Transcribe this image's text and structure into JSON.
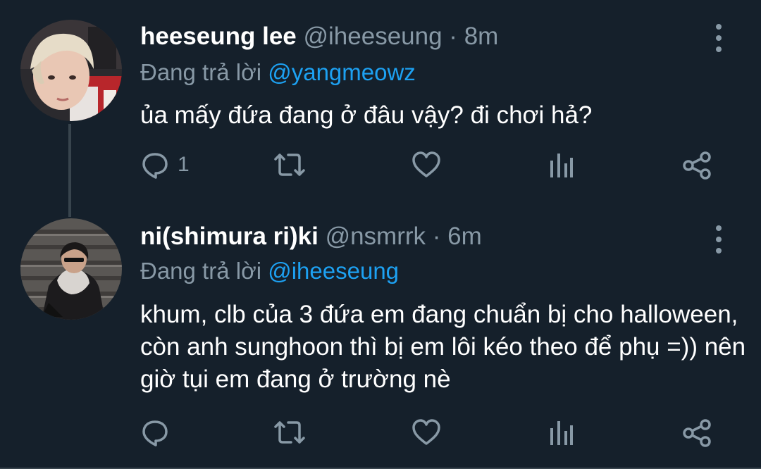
{
  "tweets": [
    {
      "display_name": "heeseung lee",
      "handle": "@iheeseung",
      "time_sep": " · ",
      "time": "8m",
      "reply_prefix": "Đang trả lời ",
      "reply_to": "@yangmeowz",
      "text": "ủa mấy đứa đang ở đâu vậy? đi chơi hả?",
      "reply_count": "1",
      "avatar": "avatar-photo-blond-hair"
    },
    {
      "display_name": "ni(shimura ri)ki",
      "handle": "@nsmrrk",
      "time_sep": " · ",
      "time": "6m",
      "reply_prefix": "Đang trả lời ",
      "reply_to": "@iheeseung",
      "text": "khum, clb của 3 đứa em đang chuẩn bị cho halloween, còn anh sunghoon thì bị em lôi kéo theo để phụ =)) nên giờ tụi em đang ở trường nè",
      "reply_count": "",
      "avatar": "avatar-photo-dark-stairs"
    }
  ],
  "icons": [
    "reply-icon",
    "retweet-icon",
    "like-icon",
    "analytics-icon",
    "share-icon",
    "more-options-icon"
  ],
  "colors": {
    "background": "#15202b",
    "secondary_text": "#8899a6",
    "link": "#1da1f2",
    "thread_line": "#38444d"
  }
}
